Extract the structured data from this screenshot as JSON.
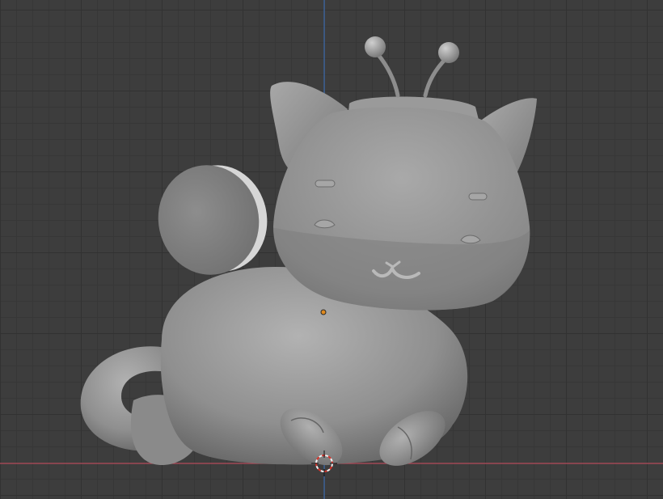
{
  "viewport": {
    "background": "#3d3d3d",
    "grid_color": "#323232",
    "x_axis_color": "#b64d5c",
    "y_axis_color": "#3f6fb0"
  },
  "model": {
    "description_icon": "cat-mesh",
    "base_color": "#8e8e8e",
    "highlight_color": "#b4b4b4",
    "shadow_color": "#5a5a5a"
  },
  "origin": {
    "color": "#e08a1e"
  },
  "cursor": {
    "icon": "3d-cursor-icon",
    "ring_color_a": "#d9332a",
    "ring_color_b": "#f2f2f2"
  }
}
